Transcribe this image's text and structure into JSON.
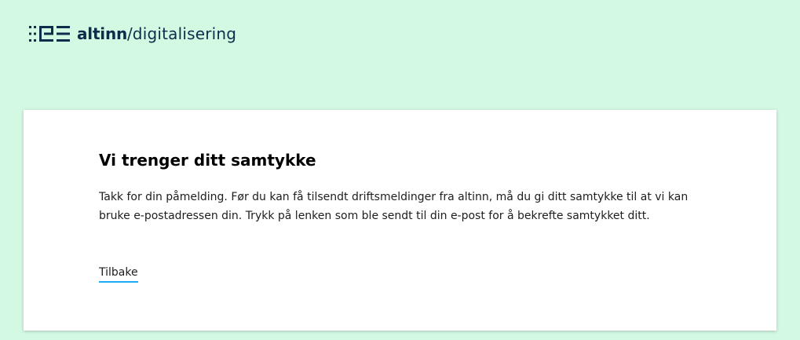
{
  "header": {
    "logo_icon": "altinn-logo-icon",
    "brand_bold": "altinn",
    "brand_slash": "/",
    "brand_sub": "digitalisering"
  },
  "card": {
    "title": "Vi trenger ditt samtykke",
    "body": "Takk for din påmelding. Før du kan få tilsendt driftsmeldinger fra altinn, må du gi ditt samtykke til at vi kan bruke e-postadressen din. Trykk på lenken som ble sendt til din e-post for å bekrefte samtykket ditt.",
    "back_link": "Tilbake"
  },
  "colors": {
    "background": "#d3f9e3",
    "brand": "#0d2e4b",
    "link_underline": "#1eaef7",
    "card": "#ffffff"
  }
}
